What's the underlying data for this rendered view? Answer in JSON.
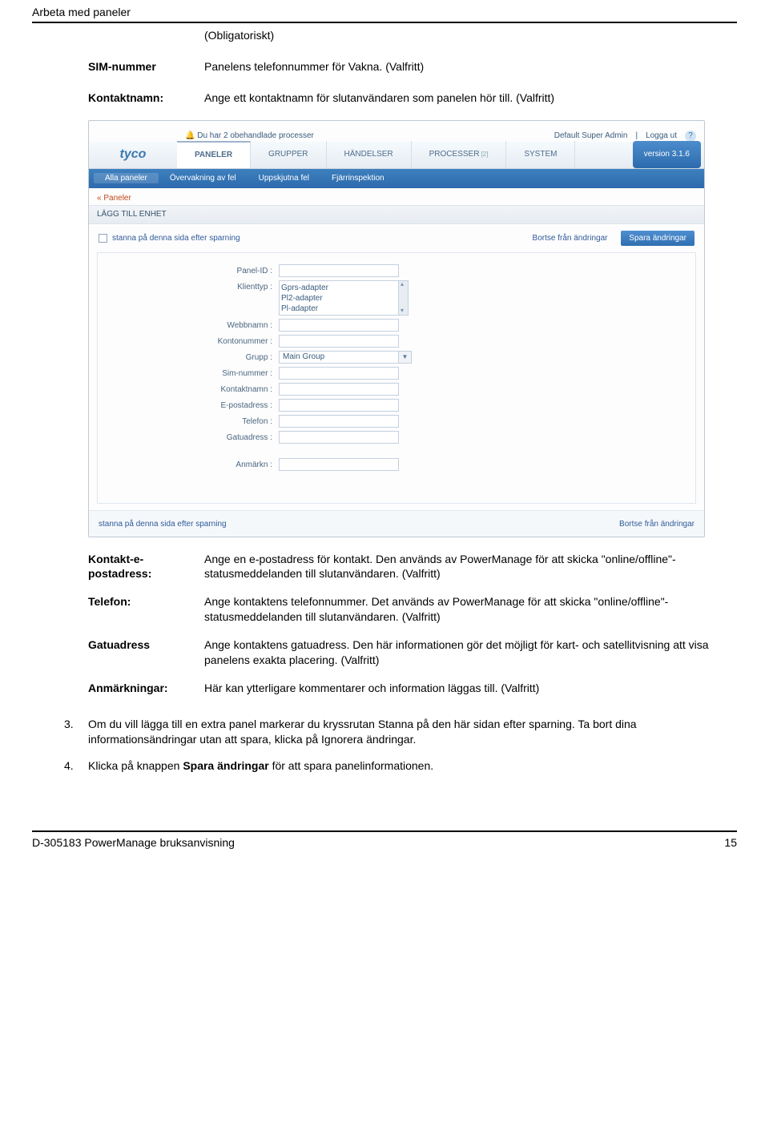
{
  "pageHeader": "Arbeta med paneler",
  "intro": [
    {
      "label": "",
      "value": "(Obligatoriskt)"
    },
    {
      "label": "SIM-nummer",
      "value": "Panelens telefonnummer för Vakna. (Valfritt)"
    },
    {
      "label": "Kontaktnamn:",
      "value": "Ange ett kontaktnamn för slutanvändaren som panelen hör till. (Valfritt)"
    }
  ],
  "shot": {
    "notify": "Du har 2 obehandlade processer",
    "userRole": "Default Super Admin",
    "logout": "Logga ut",
    "logo": "tyco",
    "tabs": [
      "PANELER",
      "GRUPPER",
      "HÄNDELSER",
      "PROCESSER",
      "SYSTEM"
    ],
    "processCount": "[2]",
    "version": "version 3.1.6",
    "subnav": [
      "Alla paneler",
      "Övervakning av fel",
      "Uppskjutna fel",
      "Fjärrinspektion"
    ],
    "breadcrumb": "« Paneler",
    "sectionTitle": "LÄGG TILL ENHET",
    "stay": "stanna på denna sida efter sparning",
    "discard": "Bortse från ändringar",
    "save": "Spara ändringar",
    "form": {
      "panelId": "Panel-ID :",
      "clientType": "Klienttyp :",
      "clientOptions": [
        "Gprs-adapter",
        "Pl2-adapter",
        "Pl-adapter"
      ],
      "webname": "Webbnamn :",
      "account": "Kontonummer :",
      "group": "Grupp :",
      "groupValue": "Main Group",
      "sim": "Sim-nummer :",
      "contact": "Kontaktnamn :",
      "email": "E-postadress :",
      "phone": "Telefon :",
      "street": "Gatuadress :",
      "remarks": "Anmärkn :"
    },
    "footerStay": "stanna på denna sida efter sparning",
    "footerDiscard": "Bortse från ändringar"
  },
  "outro": [
    {
      "label": "Kontakt-e-postadress:",
      "value": "Ange en e-postadress för kontakt. Den används av PowerManage för att skicka \"online/offline\"-statusmeddelanden till slutanvändaren. (Valfritt)"
    },
    {
      "label": "Telefon:",
      "value": "Ange kontaktens telefonnummer. Det används av PowerManage för att skicka \"online/offline\"-statusmeddelanden till slutanvändaren. (Valfritt)"
    },
    {
      "label": "Gatuadress",
      "value": "Ange kontaktens gatuadress. Den här informationen gör det möjligt för kart- och satellitvisning att visa panelens exakta placering. (Valfritt)"
    },
    {
      "label": "Anmärkningar:",
      "value": "Här kan ytterligare kommentarer och information läggas till. (Valfritt)"
    }
  ],
  "steps": {
    "s3": {
      "text_a": "Om du vill lägga till en extra panel markerar du kryssrutan Stanna på den här sidan efter sparning. Ta bort dina informationsändringar utan att spara, klicka på Ignorera ändringar."
    },
    "s4": {
      "text_a": "Klicka på knappen ",
      "bold": "Spara ändringar",
      "text_b": " för att spara panelinformationen."
    }
  },
  "footerLeft": "D-305183 PowerManage bruksanvisning",
  "footerRight": "15"
}
